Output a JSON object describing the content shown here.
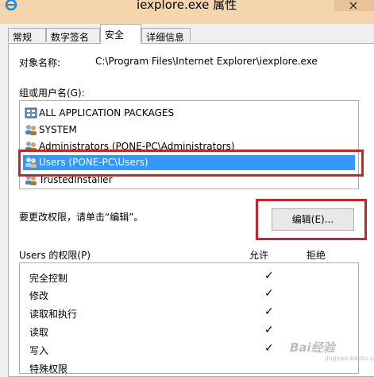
{
  "window": {
    "title": "iexplore.exe 属性",
    "app_icon": "internet-explorer-icon",
    "close_icon": "close-icon"
  },
  "tabs": [
    {
      "label": "常规",
      "active": false
    },
    {
      "label": "数字签名",
      "active": false
    },
    {
      "label": "安全",
      "active": true
    },
    {
      "label": "详细信息",
      "active": false
    }
  ],
  "security": {
    "object_name_label": "对象名称:",
    "object_name_value": "C:\\Program Files\\Internet Explorer\\iexplore.exe",
    "group_label": "组或用户名(G):",
    "users": [
      {
        "name": "ALL APPLICATION PACKAGES",
        "icon": "app-packages-icon",
        "selected": false
      },
      {
        "name": "SYSTEM",
        "icon": "user-group-icon",
        "selected": false
      },
      {
        "name": "Administrators (PONE-PC\\Administrators)",
        "icon": "user-group-icon",
        "selected": false
      },
      {
        "name": "Users (PONE-PC\\Users)",
        "icon": "user-group-icon",
        "selected": true
      },
      {
        "name": "TrustedInstaller",
        "icon": "user-group-icon",
        "selected": false
      }
    ],
    "edit_hint": "要更改权限，请单击“编辑”。",
    "edit_button": "编辑(E)...",
    "permissions_label": "Users 的权限(P)",
    "allow_header": "允许",
    "deny_header": "拒绝",
    "permissions": [
      {
        "name": "完全控制",
        "allow": "✓"
      },
      {
        "name": "修改",
        "allow": "✓"
      },
      {
        "name": "读取和执行",
        "allow": "✓"
      },
      {
        "name": "读取",
        "allow": "✓"
      },
      {
        "name": "写入",
        "allow": "✓"
      },
      {
        "name": "特殊权限",
        "allow": ""
      }
    ]
  },
  "watermark": {
    "text": "Bai经验",
    "sub": "jingyan.baidu.com"
  },
  "colors": {
    "titlebar": "#f5d5ac",
    "selection": "#3399ff",
    "highlight_box": "#c0282d"
  }
}
